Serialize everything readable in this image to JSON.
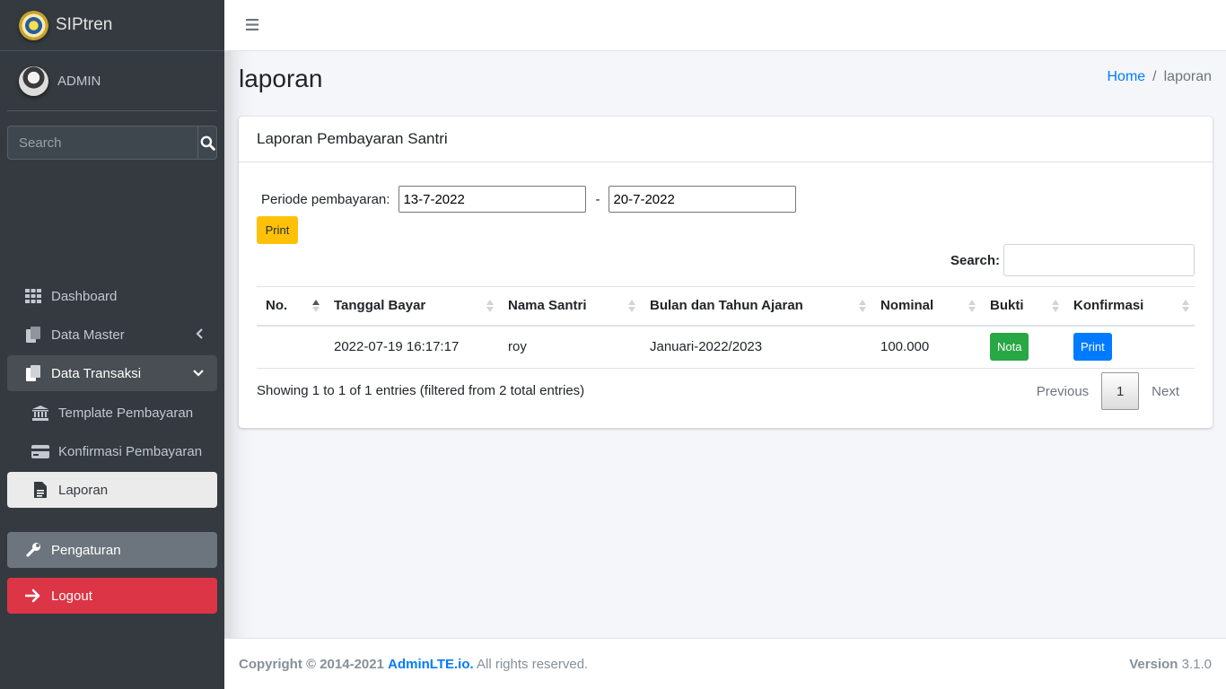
{
  "brand": {
    "name": "SIPtren",
    "logo_icon": "seal-logo"
  },
  "user": {
    "name": "ADMIN",
    "avatar_icon": "user-avatar"
  },
  "sidebar_search": {
    "placeholder": "Search"
  },
  "sidebar": {
    "items": [
      {
        "label": "Dashboard",
        "icon": "grid-icon"
      },
      {
        "label": "Data Master",
        "icon": "copy-icon",
        "arrow": "chevron-left-icon"
      },
      {
        "label": "Data Transaksi",
        "icon": "copy-icon",
        "arrow": "chevron-down-icon"
      },
      {
        "label": "Template Pembayaran",
        "icon": "bank-icon"
      },
      {
        "label": "Konfirmasi Pembayaran",
        "icon": "credit-card-icon"
      },
      {
        "label": "Laporan",
        "icon": "file-icon"
      }
    ],
    "settings_label": "Pengaturan",
    "logout_label": "Logout"
  },
  "header": {
    "title": "laporan"
  },
  "breadcrumb": {
    "home": "Home",
    "separator": "/",
    "current": "laporan"
  },
  "card": {
    "title": "Laporan Pembayaran Santri",
    "periode_label": "Periode pembayaran:",
    "date_from": "13-7-2022",
    "date_separator": "-",
    "date_to": "20-7-2022",
    "print_label": "Print",
    "search_label": "Search:",
    "search_value": ""
  },
  "table": {
    "columns": [
      "No.",
      "Tanggal Bayar",
      "Nama Santri",
      "Bulan dan Tahun Ajaran",
      "Nominal",
      "Bukti",
      "Konfirmasi"
    ],
    "rows": [
      {
        "no": "",
        "tanggal": "2022-07-19 16:17:17",
        "nama": "roy",
        "bulan": "Januari-2022/2023",
        "nominal": "100.000",
        "bukti": "Nota",
        "konfirmasi": "Print"
      }
    ]
  },
  "table_info": "Showing 1 to 1 of 1 entries (filtered from 2 total entries)",
  "pagination": {
    "previous": "Previous",
    "current": "1",
    "next": "Next"
  },
  "footer": {
    "copyright": "Copyright © 2014-2021",
    "company": "AdminLTE.io.",
    "rights": "All rights reserved.",
    "version_label": "Version",
    "version": "3.1.0"
  },
  "colors": {
    "sidebar": "#343a40",
    "primary": "#007bff",
    "warning": "#ffc107",
    "success": "#28a745",
    "danger": "#dc3545"
  }
}
